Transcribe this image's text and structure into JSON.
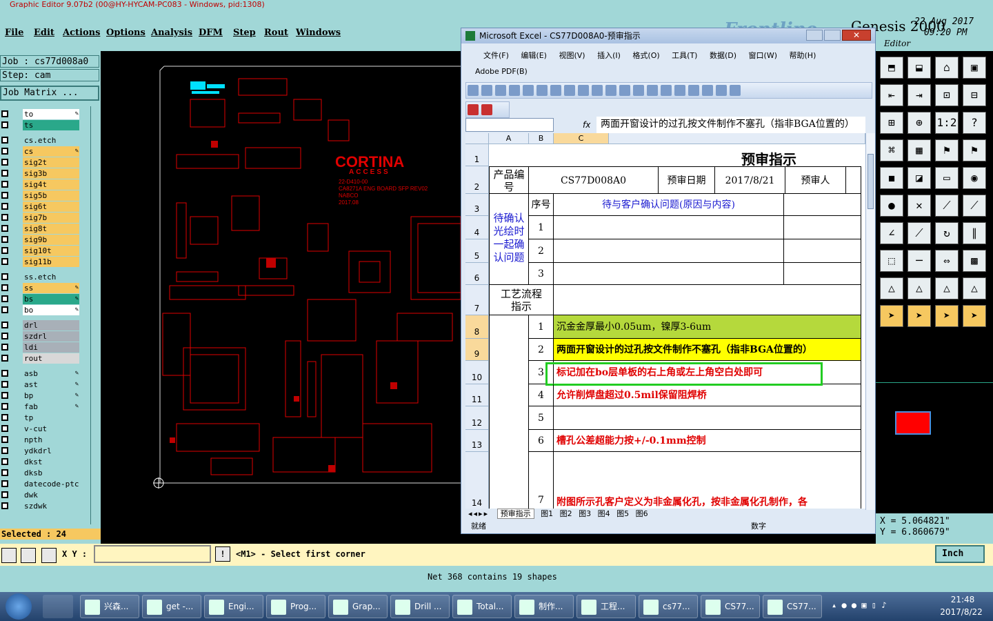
{
  "window": {
    "title": "Graphic Editor 9.07b2 (00@HY-HYCAM-PC083 - Windows, pid:1308)"
  },
  "menu": [
    "File",
    "Edit",
    "Actions",
    "Options",
    "Analysis",
    "DFM",
    "Step",
    "Rout",
    "Windows"
  ],
  "brand": {
    "name": "Genesis 2000",
    "sub": "Editor",
    "date": "22 Aug 2017",
    "time": "09:20 PM",
    "ghost": "Frontline"
  },
  "job": {
    "job_label": "Job : cs77d008a0",
    "step_label": "Step: cam",
    "matrix_button": "Job Matrix ..."
  },
  "layers": [
    {
      "name": "to",
      "color": "#ffffff",
      "pen": true
    },
    {
      "name": "ts",
      "color": "#2aa88a",
      "pen": false
    },
    {
      "name": "cs.etch",
      "color": "#a1d7d7",
      "pen": false
    },
    {
      "name": "cs",
      "color": "#f6c860",
      "pen": true
    },
    {
      "name": "sig2t",
      "color": "#f6c860",
      "pen": false
    },
    {
      "name": "sig3b",
      "color": "#f6c860",
      "pen": false
    },
    {
      "name": "sig4t",
      "color": "#f6c860",
      "pen": false
    },
    {
      "name": "sig5b",
      "color": "#f6c860",
      "pen": false
    },
    {
      "name": "sig6t",
      "color": "#f6c860",
      "pen": false
    },
    {
      "name": "sig7b",
      "color": "#f6c860",
      "pen": false
    },
    {
      "name": "sig8t",
      "color": "#f6c860",
      "pen": false
    },
    {
      "name": "sig9b",
      "color": "#f6c860",
      "pen": false
    },
    {
      "name": "sig10t",
      "color": "#f6c860",
      "pen": false
    },
    {
      "name": "sig11b",
      "color": "#f6c860",
      "pen": false
    },
    {
      "name": "ss.etch",
      "color": "#a1d7d7",
      "pen": false
    },
    {
      "name": "ss",
      "color": "#f6c860",
      "pen": true
    },
    {
      "name": "bs",
      "color": "#2aa88a",
      "pen": true
    },
    {
      "name": "bo",
      "color": "#ffffff",
      "pen": true
    },
    {
      "name": "drl",
      "color": "#a8b0b8",
      "pen": false
    },
    {
      "name": "szdrl",
      "color": "#a8b0b8",
      "pen": false
    },
    {
      "name": "ldi",
      "color": "#a8b0b8",
      "pen": false
    },
    {
      "name": "rout",
      "color": "#d8d8d8",
      "pen": false
    },
    {
      "name": "asb",
      "color": "#a1d7d7",
      "pen": true
    },
    {
      "name": "ast",
      "color": "#a1d7d7",
      "pen": true
    },
    {
      "name": "bp",
      "color": "#a1d7d7",
      "pen": true
    },
    {
      "name": "fab",
      "color": "#a1d7d7",
      "pen": true
    },
    {
      "name": "tp",
      "color": "#a1d7d7",
      "pen": false
    },
    {
      "name": "v-cut",
      "color": "#a1d7d7",
      "pen": false
    },
    {
      "name": "npth",
      "color": "#a1d7d7",
      "pen": false
    },
    {
      "name": "ydkdrl",
      "color": "#a1d7d7",
      "pen": false
    },
    {
      "name": "dkst",
      "color": "#a1d7d7",
      "pen": false
    },
    {
      "name": "dksb",
      "color": "#a1d7d7",
      "pen": false
    },
    {
      "name": "datecode-ptc",
      "color": "#a1d7d7",
      "pen": false
    },
    {
      "name": "dwk",
      "color": "#a1d7d7",
      "pen": false
    },
    {
      "name": "szdwk",
      "color": "#a1d7d7",
      "pen": false
    }
  ],
  "selected": "Selected : 24",
  "board": {
    "brand": "CORTINA",
    "brand_sub": "ACCESS",
    "lines": [
      "22-D410-00",
      "CA8271A ENG BOARD SFP REV02",
      "NABCO",
      "2017.08"
    ]
  },
  "excel": {
    "title": "Microsoft Excel - CS77D008A0-预审指示",
    "menu": [
      "文件(F)",
      "编辑(E)",
      "视图(V)",
      "插入(I)",
      "格式(O)",
      "工具(T)",
      "数据(D)",
      "窗口(W)",
      "帮助(H)"
    ],
    "pdf_menu": "Adobe PDF(B)",
    "fx": "fx",
    "formula": "两面开窗设计的过孔按文件制作不塞孔（指非BGA位置的）",
    "columns": [
      "A",
      "B",
      "C"
    ],
    "rows": [
      "1",
      "2",
      "3",
      "4",
      "5",
      "6",
      "7",
      "8",
      "9",
      "10",
      "11",
      "12",
      "13",
      "14"
    ],
    "sheet_title": "预审指示",
    "product_label": "产品编号",
    "product_no": "CS77D008A0",
    "review_date_label": "预审日期",
    "review_date": "2017/8/21",
    "reviewer_label": "预审人",
    "seq_label": "序号",
    "pending_header": "待与客户确认问题(原因与内容)",
    "pending_label": "待确认光绘时一起确认问题",
    "pending_nums": [
      "1",
      "2",
      "3"
    ],
    "process_label": "工艺流程指示",
    "items": [
      {
        "n": "1",
        "text": "沉金金厚最小0.05um，镍厚3-6um"
      },
      {
        "n": "2",
        "text": "两面开窗设计的过孔按文件制作不塞孔（指非BGA位置的）"
      },
      {
        "n": "3",
        "text": "标记加在bo层单板的右上角或左上角空白处即可"
      },
      {
        "n": "4",
        "text": "允许削焊盘超过0.5mil保留阻焊桥"
      },
      {
        "n": "5",
        "text": ""
      },
      {
        "n": "6",
        "text": "槽孔公差超能力按+/-0.1mm控制"
      },
      {
        "n": "7",
        "text": "附图所示孔客户定义为非金属化孔，按非金属化孔制作，各"
      }
    ],
    "tabs": [
      "预审指示",
      "图1",
      "图2",
      "图3",
      "图4",
      "图5",
      "图6"
    ],
    "status": "就绪",
    "status_num": "数字",
    "colors": {
      "green": "#b5d93c",
      "yellow": "#ffff00",
      "red_text": "#e00000",
      "blue_text": "#1a1ad0",
      "highlight": "#22cc22"
    }
  },
  "coords": {
    "x": "X = 5.064821\"",
    "y": "Y = 6.860679\""
  },
  "bottom": {
    "xy_label": "X Y :",
    "prompt": "<M1> - Select first corner",
    "units": "Inch"
  },
  "status": {
    "net": "Net 368 contains 19 shapes"
  },
  "taskbar": {
    "items": [
      "兴森...",
      "get -...",
      "Engi...",
      "Prog...",
      "Grap...",
      "Drill ...",
      "Total...",
      "制作...",
      "工程...",
      "cs77...",
      "CS77...",
      "CS77..."
    ],
    "time": "21:48",
    "date": "2017/8/22"
  }
}
